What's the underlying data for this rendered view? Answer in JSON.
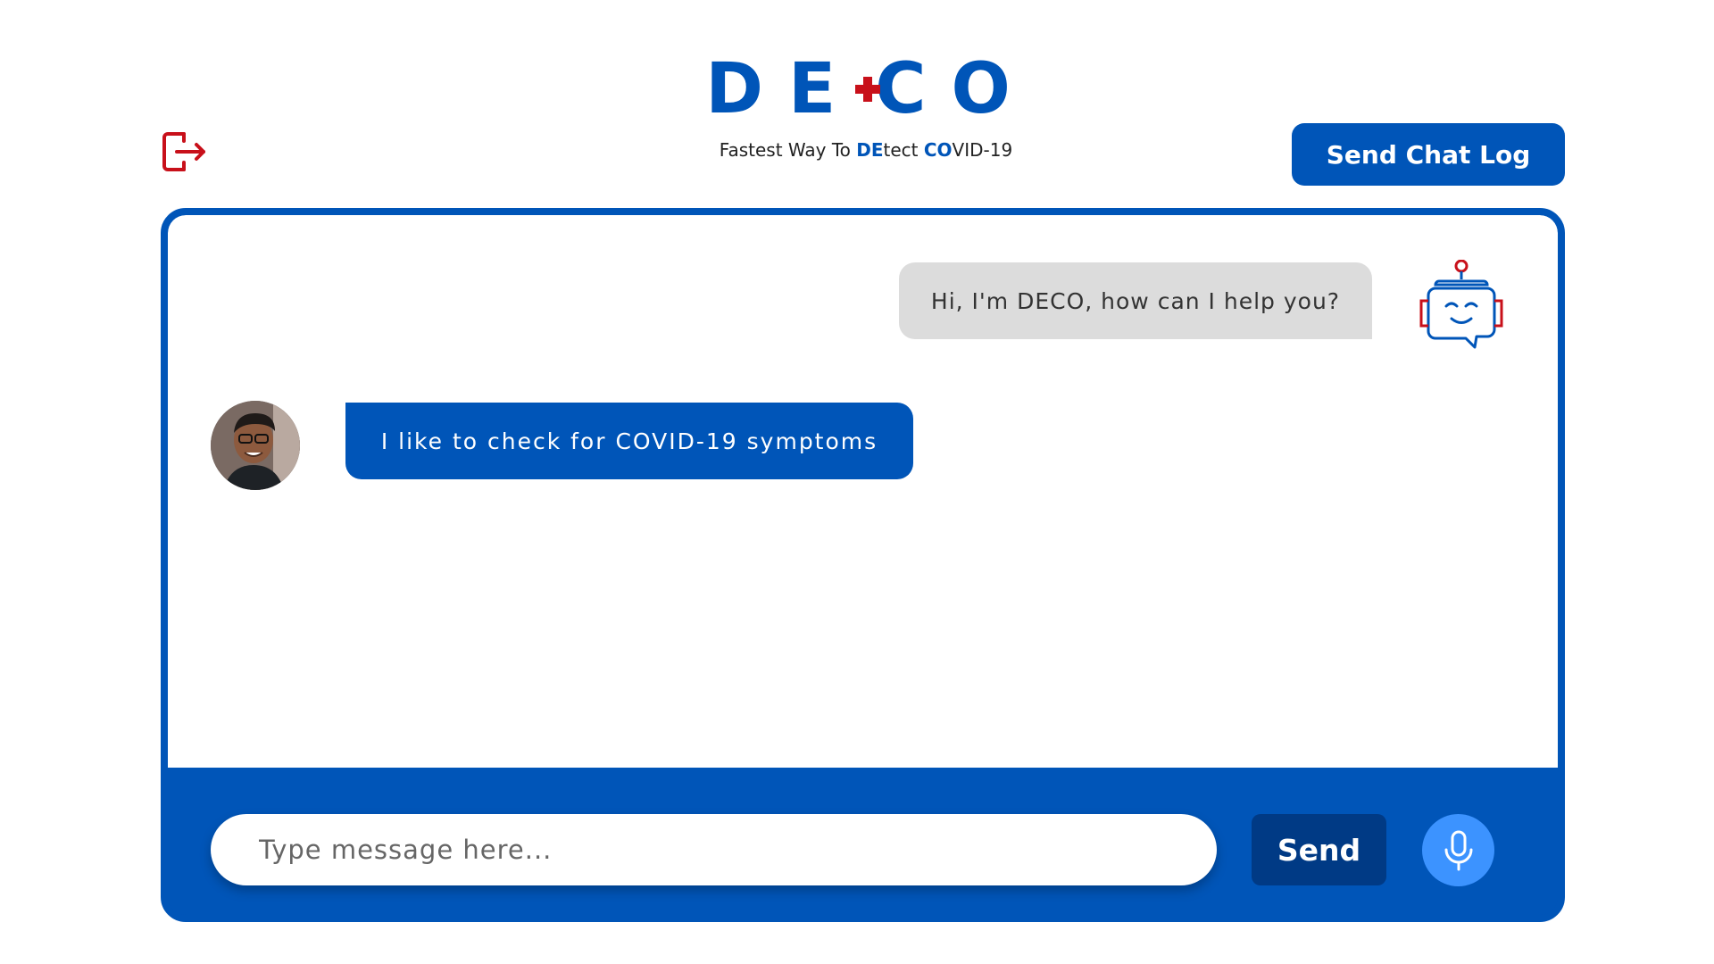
{
  "brand": {
    "logo_left": "DE",
    "logo_right": "CO",
    "tagline_prefix": "Fastest Way To ",
    "tagline_de": "DE",
    "tagline_tect": "tect ",
    "tagline_co": "CO",
    "tagline_suffix": "VID-19"
  },
  "header": {
    "send_chat_log_label": "Send Chat Log",
    "logout_icon": "logout-icon"
  },
  "messages": [
    {
      "sender": "bot",
      "text": "Hi, I'm DECO, how can I help you?"
    },
    {
      "sender": "user",
      "text": "I like to check for COVID-19 symptoms"
    }
  ],
  "composer": {
    "placeholder": "Type message here...",
    "value": "",
    "send_label": "Send",
    "mic_icon": "microphone-icon"
  },
  "colors": {
    "primary": "#0055b8",
    "dark_primary": "#003a85",
    "mic_blue": "#3c93ff",
    "accent_red": "#c8101a",
    "bot_bubble": "#dcdcdc"
  }
}
